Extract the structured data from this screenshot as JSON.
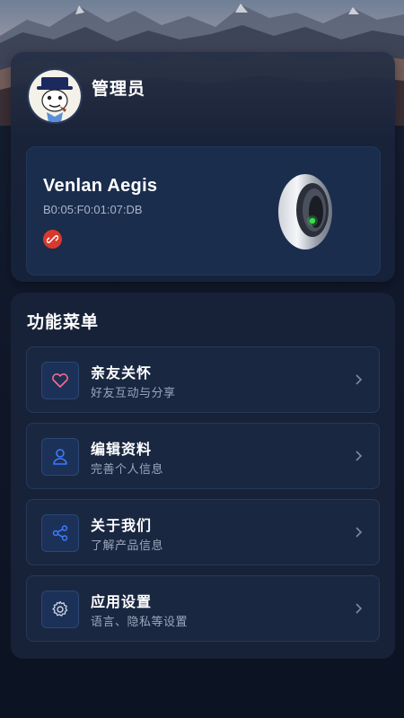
{
  "profile": {
    "user_name": "管理员",
    "device": {
      "name": "Venlan Aegis",
      "mac": "B0:05:F0:01:07:DB",
      "connection_status_icon": "link-broken-icon",
      "status_color": "#d9392c"
    }
  },
  "menu": {
    "title": "功能菜单",
    "items": [
      {
        "label": "亲友关怀",
        "subtitle": "好友互动与分享",
        "icon": "heart-icon"
      },
      {
        "label": "编辑资料",
        "subtitle": "完善个人信息",
        "icon": "user-icon"
      },
      {
        "label": "关于我们",
        "subtitle": "了解产品信息",
        "icon": "share-icon"
      },
      {
        "label": "应用设置",
        "subtitle": "语言、隐私等设置",
        "icon": "gear-icon"
      }
    ]
  },
  "colors": {
    "background": "#0d1526",
    "card": "#172238",
    "device_card": "#1a2d4d",
    "accent_blue": "#3d7bff",
    "heart_pink": "#ff6b8a",
    "ring_led": "#35e04a"
  }
}
